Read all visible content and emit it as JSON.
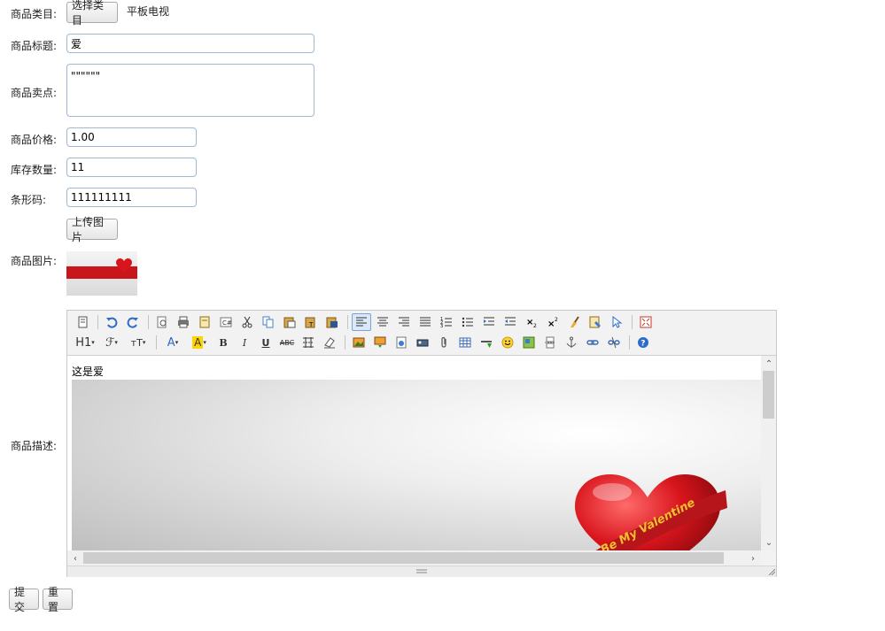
{
  "form": {
    "category_label": "商品类目:",
    "category_button": "选择类目",
    "category_value": "平板电视",
    "title_label": "商品标题:",
    "title_value": "爱",
    "sell_point_label": "商品卖点:",
    "sell_point_value": "\"\"\"\"\"\"",
    "price_label": "商品价格:",
    "price_value": "1.00",
    "stock_label": "库存数量:",
    "stock_value": "11",
    "barcode_label": "条形码:",
    "barcode_value": "111111111",
    "upload_button": "上传图片",
    "image_label": "商品图片:",
    "description_label": "商品描述:",
    "submit_button": "提交",
    "reset_button": "重置"
  },
  "editor": {
    "content_text": "这是爱",
    "heart_text": "Be My Valentine",
    "toolbar_h1": "H1",
    "toolbar_font": "ℱ",
    "toolbar_size": "тT",
    "toolbar_bold": "B",
    "toolbar_italic": "I",
    "toolbar_underline": "U",
    "toolbar_strike": "ABC"
  },
  "colors": {
    "accent_border": "#9fb8d6",
    "heart_red": "#d8141c",
    "ribbon": "#b5151b",
    "ribbon_text": "#f3c12c"
  },
  "icons": [
    "source-icon",
    "undo-icon",
    "redo-icon",
    "preview-icon",
    "print-icon",
    "template-icon",
    "code-icon",
    "cut-icon",
    "copy-icon",
    "paste-icon",
    "paste-text-icon",
    "paste-word-icon",
    "align-left-icon",
    "align-center-icon",
    "align-right-icon",
    "justify-icon",
    "ordered-list-icon",
    "unordered-list-icon",
    "indent-icon",
    "outdent-icon",
    "subscript-icon",
    "superscript-icon",
    "clear-format-icon",
    "select-all-icon",
    "select-icon",
    "fullscreen-icon",
    "font-color-icon",
    "highlight-icon",
    "line-height-icon",
    "remove-format-icon",
    "image-icon",
    "multi-image-icon",
    "flash-icon",
    "media-icon",
    "attachment-icon",
    "table-icon",
    "hr-icon",
    "emoticon-icon",
    "map-icon",
    "pagebreak-icon",
    "anchor-icon",
    "link-icon",
    "unlink-icon",
    "help-icon"
  ]
}
